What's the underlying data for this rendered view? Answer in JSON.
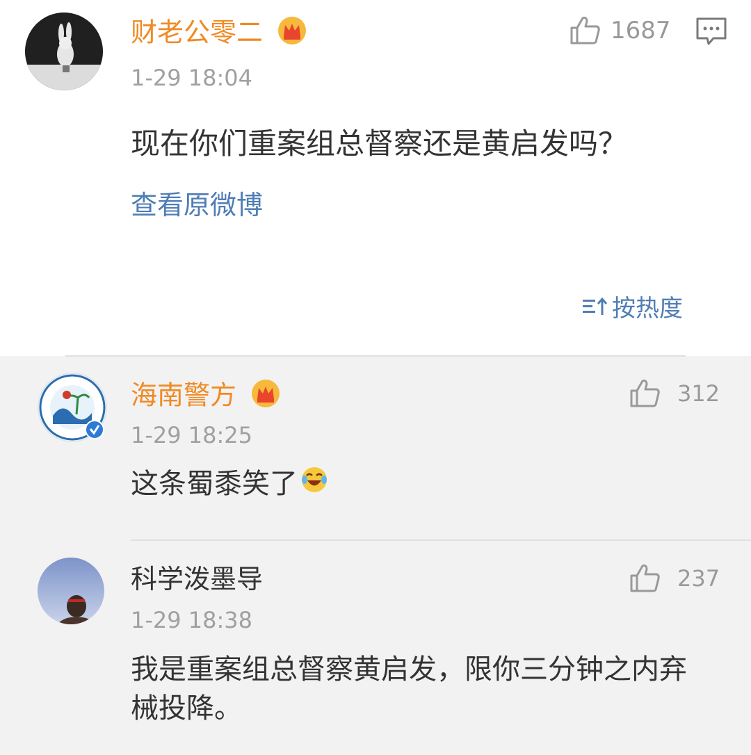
{
  "main_comment": {
    "username": "财老公零二",
    "time": "1-29 18:04",
    "likes": "1687",
    "text": "现在你们重案组总督察还是黄启发吗？",
    "view_original": "查看原微博"
  },
  "sort": {
    "label": "按热度"
  },
  "replies": [
    {
      "username": "海南警方",
      "time": "1-29 18:25",
      "likes": "312",
      "text": "这条蜀黍笑了"
    },
    {
      "username": "科学泼墨导",
      "time": "1-29 18:38",
      "likes": "237",
      "text_line1": "我是重案组总督察黄启发，限你三分钟之内弃",
      "text_line2": "械投降。"
    }
  ],
  "colors": {
    "vip_name": "#f08a24",
    "link": "#4f7db5",
    "muted": "#a0a0a0"
  },
  "icons": [
    "crown-icon",
    "thumb-up-icon",
    "comment-icon",
    "sort-icon",
    "verified-icon",
    "laugh-cry-emoji"
  ]
}
